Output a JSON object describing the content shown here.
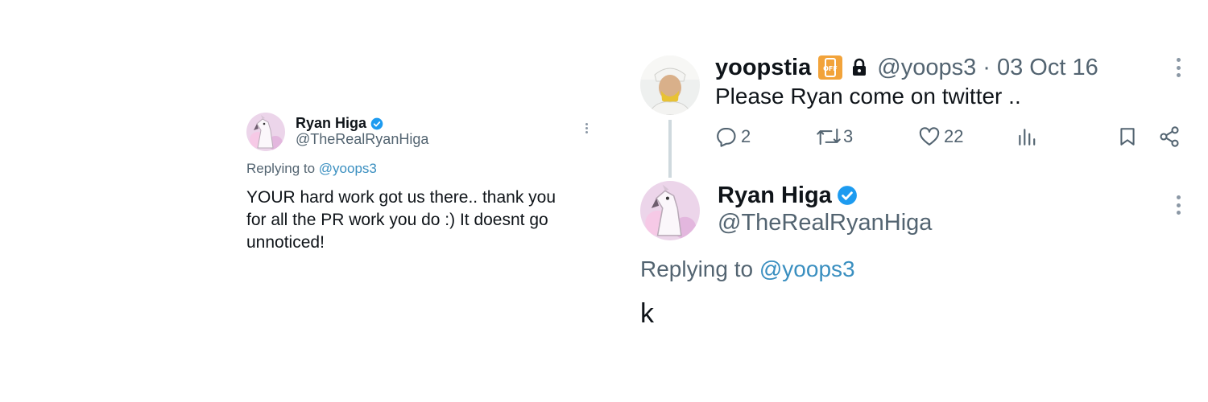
{
  "left_tweet": {
    "author_name": "Ryan Higa",
    "author_handle": "@TheRealRyanHiga",
    "replying_prefix": "Replying to",
    "replying_to": "@yoops3",
    "text": "YOUR hard work got us there.. thank you for all the PR work you do :) It doesnt go unnoticed!"
  },
  "thread": {
    "parent": {
      "author_name": "yoopstia",
      "badge_icon": "off-phone-emoji",
      "lock_icon": "lock-icon",
      "handle_and_date": "@yoops3 · 03 Oct 16",
      "text": "Please Ryan come on twitter ..",
      "actions": {
        "replies": "2",
        "retweets": "3",
        "likes": "22"
      }
    },
    "reply": {
      "author_name": "Ryan Higa",
      "author_handle": "@TheRealRyanHiga",
      "replying_prefix": "Replying to",
      "replying_to": "@yoops3",
      "text": "k"
    }
  },
  "colors": {
    "verified": "#1d9bf0",
    "link": "#3a8fc0",
    "muted": "#536471",
    "text": "#0f1419"
  }
}
